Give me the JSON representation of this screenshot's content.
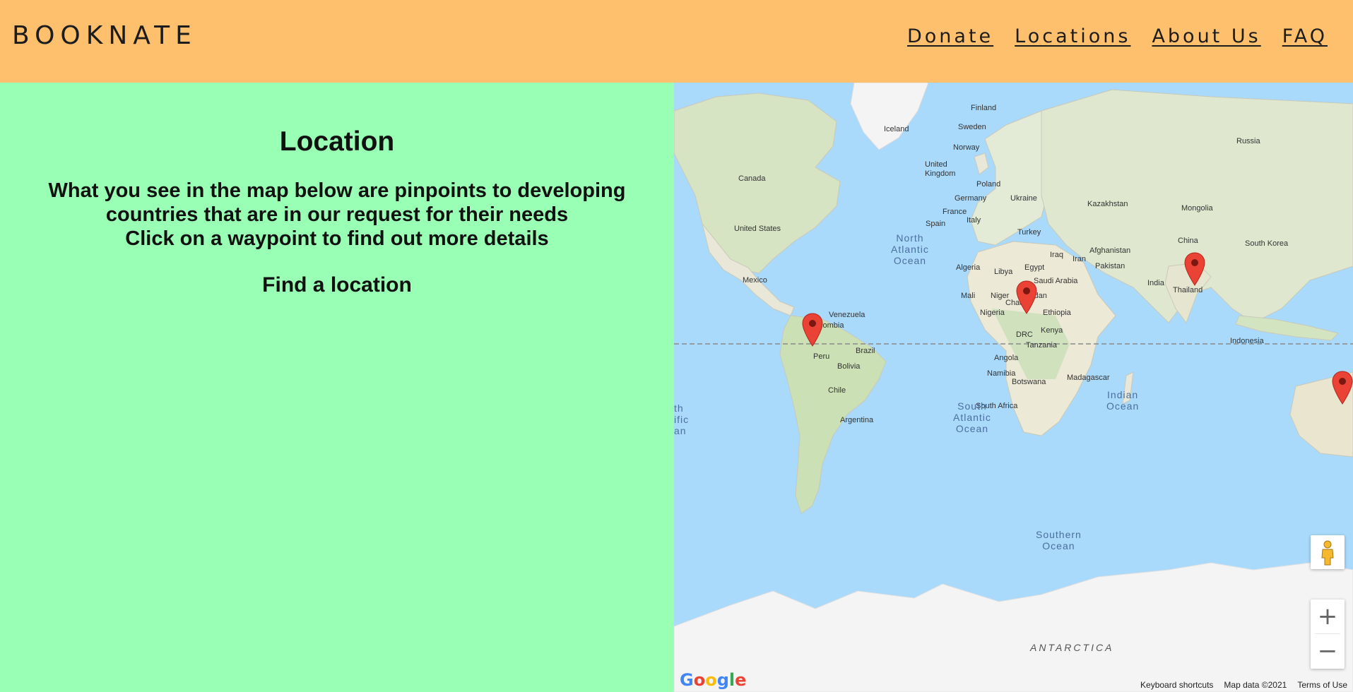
{
  "header": {
    "logo": "BOOKNATE",
    "nav": [
      "Donate",
      "Locations",
      "About Us",
      "FAQ"
    ]
  },
  "content": {
    "title": "Location",
    "description_line1": "What you see in the map below are pinpoints to developing",
    "description_line2": "countries that are in our request for their needs",
    "description_line3": "Click on a waypoint to find out more details",
    "find_label": "Find a location"
  },
  "map": {
    "countries": [
      "Finland",
      "Sweden",
      "Russia",
      "Iceland",
      "Norway",
      "Canada",
      "United Kingdom",
      "Poland",
      "Germany",
      "Ukraine",
      "Kazakhstan",
      "Mongolia",
      "France",
      "Spain",
      "Italy",
      "United States",
      "Turkey",
      "China",
      "South Korea",
      "Afghanistan",
      "Iraq",
      "Iran",
      "Pakistan",
      "North Atlantic Ocean",
      "Algeria",
      "Libya",
      "Egypt",
      "Mexico",
      "Saudi Arabia",
      "India",
      "Thailand",
      "Mali",
      "Niger",
      "Chad",
      "Sudan",
      "Venezuela",
      "Colombia",
      "Nigeria",
      "Ethiopia",
      "Kenya",
      "DRC",
      "Indonesia",
      "Brazil",
      "Tanzania",
      "Peru",
      "Bolivia",
      "Angola",
      "Namibia",
      "Madagascar",
      "Botswana",
      "Chile",
      "South Africa",
      "Argentina",
      "ANTARCTICA"
    ],
    "oceans": {
      "north_atlantic": "North\nAtlantic\nOcean",
      "south_atlantic": "South\nAtlantic\nOcean",
      "indian": "Indian\nOcean",
      "southern": "Southern\nOcean",
      "south_pacific_partial": "th\nific\nan"
    },
    "colors": {
      "water": "#a9d9fb",
      "land": "#e8e7d8",
      "vegetation": "#c6dfb6",
      "pin": "#ea4335",
      "ice": "#f4f4f4"
    },
    "footer": [
      "Keyboard shortcuts",
      "Map data ©2021",
      "Terms of Use"
    ],
    "google_logo": "Google",
    "zoom_in": "+",
    "zoom_out": "−"
  }
}
